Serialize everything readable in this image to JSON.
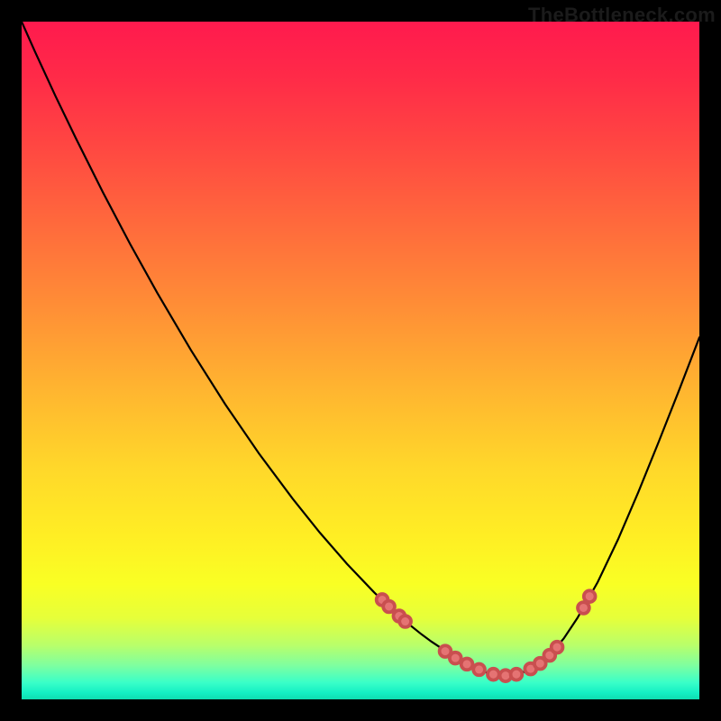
{
  "watermark": "TheBottleneck.com",
  "colors": {
    "background": "#000000",
    "curve_stroke": "#000000",
    "dot_fill": "#e57373",
    "dot_stroke": "#c94f4f",
    "gradient_stops": [
      "#ff1a4e",
      "#ff2a48",
      "#ff4642",
      "#ff6a3c",
      "#ff8e36",
      "#ffb430",
      "#ffd82a",
      "#ffee24",
      "#f9ff24",
      "#e6ff3a",
      "#b9ff6a",
      "#7effa0",
      "#3affc8",
      "#14f0c4",
      "#0fdcb0"
    ]
  },
  "chart_data": {
    "type": "line",
    "title": "",
    "xlabel": "",
    "ylabel": "",
    "xlim": [
      0,
      100
    ],
    "ylim": [
      0,
      100
    ],
    "grid": false,
    "legend": null,
    "x": [
      0,
      2,
      5,
      8,
      12,
      16,
      20,
      25,
      30,
      35,
      40,
      44,
      48,
      52,
      55,
      57,
      59,
      60.5,
      62,
      63.5,
      65,
      66.5,
      68,
      69,
      70,
      71,
      72.5,
      74,
      76,
      78,
      80,
      82,
      85,
      88,
      91,
      94,
      97,
      100
    ],
    "y": [
      100,
      95.5,
      89,
      82.8,
      74.8,
      67.2,
      60,
      51.5,
      43.6,
      36.3,
      29.6,
      24.6,
      20,
      15.8,
      12.9,
      11.2,
      9.6,
      8.5,
      7.5,
      6.5,
      5.6,
      4.8,
      4.2,
      3.8,
      3.6,
      3.5,
      3.6,
      4,
      5,
      6.6,
      9,
      12,
      17.3,
      23.6,
      30.6,
      38,
      45.6,
      53.4
    ],
    "dots": [
      {
        "x": 53.2,
        "y": 14.7
      },
      {
        "x": 54.2,
        "y": 13.7
      },
      {
        "x": 55.7,
        "y": 12.3
      },
      {
        "x": 56.6,
        "y": 11.5
      },
      {
        "x": 62.5,
        "y": 7.1
      },
      {
        "x": 64.0,
        "y": 6.1
      },
      {
        "x": 65.7,
        "y": 5.2
      },
      {
        "x": 67.5,
        "y": 4.4
      },
      {
        "x": 69.6,
        "y": 3.7
      },
      {
        "x": 71.4,
        "y": 3.5
      },
      {
        "x": 73.0,
        "y": 3.7
      },
      {
        "x": 75.1,
        "y": 4.5
      },
      {
        "x": 76.5,
        "y": 5.3
      },
      {
        "x": 77.9,
        "y": 6.5
      },
      {
        "x": 79.0,
        "y": 7.7
      },
      {
        "x": 82.9,
        "y": 13.5
      },
      {
        "x": 83.8,
        "y": 15.2
      }
    ],
    "dot_radius": 0.85
  }
}
